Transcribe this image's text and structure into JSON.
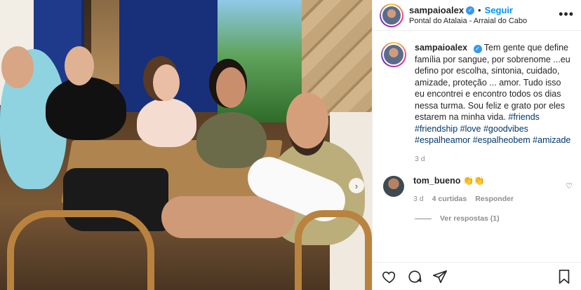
{
  "post": {
    "username": "sampaioalex",
    "follow_label": "Seguir",
    "separator": "•",
    "location": "Pontal do Atalaia - Arraial do Cabo",
    "more_label": "•••",
    "caption_text": "Tem gente que define família por sangue, por sobrenome ...eu defino por escolha, sintonia, cuidado, amizade, proteção ... amor. Tudo isso eu encontrei e encontro todos os dias nessa turma. Sou feliz e grato por eles estarem na minha vida.",
    "hashtags": "#friends #friendship #love #goodvibes #espalheamor #espalheobem #amizade",
    "time": "3 d"
  },
  "comments": [
    {
      "username": "tom_bueno",
      "text": "👏👏",
      "time": "3 d",
      "likes": "4 curtidas",
      "reply_label": "Responder",
      "view_replies": "Ver respostas (1)"
    }
  ],
  "icons": {
    "verified": "verified-badge-icon",
    "heart": "heart-icon",
    "comment": "comment-icon",
    "share": "share-icon",
    "bookmark": "bookmark-icon",
    "carousel_next": "chevron-right-icon"
  },
  "colors": {
    "link": "#0095f6",
    "hashtag": "#00376b",
    "muted": "#8e8e8e",
    "verified": "#3897f0"
  }
}
